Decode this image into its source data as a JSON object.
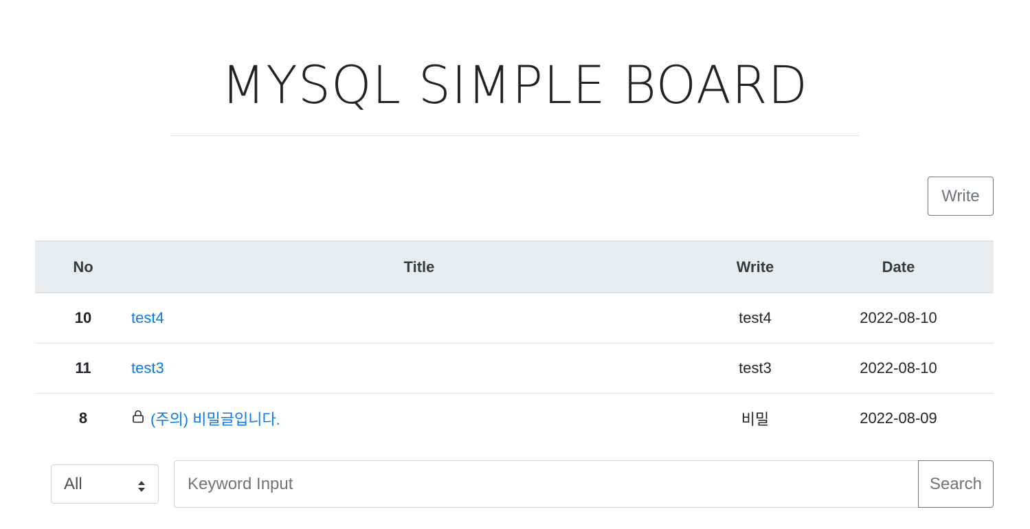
{
  "header": {
    "title": "MYSQL SIMPLE BOARD"
  },
  "toolbar": {
    "write_label": "Write"
  },
  "table": {
    "columns": {
      "no": "No",
      "title": "Title",
      "writer": "Write",
      "date": "Date"
    },
    "rows": [
      {
        "no": "10",
        "title": "test4",
        "writer": "test4",
        "date": "2022-08-10",
        "locked": false
      },
      {
        "no": "11",
        "title": "test3",
        "writer": "test3",
        "date": "2022-08-10",
        "locked": false
      },
      {
        "no": "8",
        "title": "(주의) 비밀글입니다.",
        "writer": "비밀",
        "date": "2022-08-09",
        "locked": true
      }
    ]
  },
  "search": {
    "filter_selected": "All",
    "keyword_placeholder": "Keyword Input",
    "keyword_value": "",
    "button_label": "Search"
  },
  "colors": {
    "link": "#0a7be6",
    "header_bg": "#e9ecef",
    "button_border": "#6c757d"
  }
}
